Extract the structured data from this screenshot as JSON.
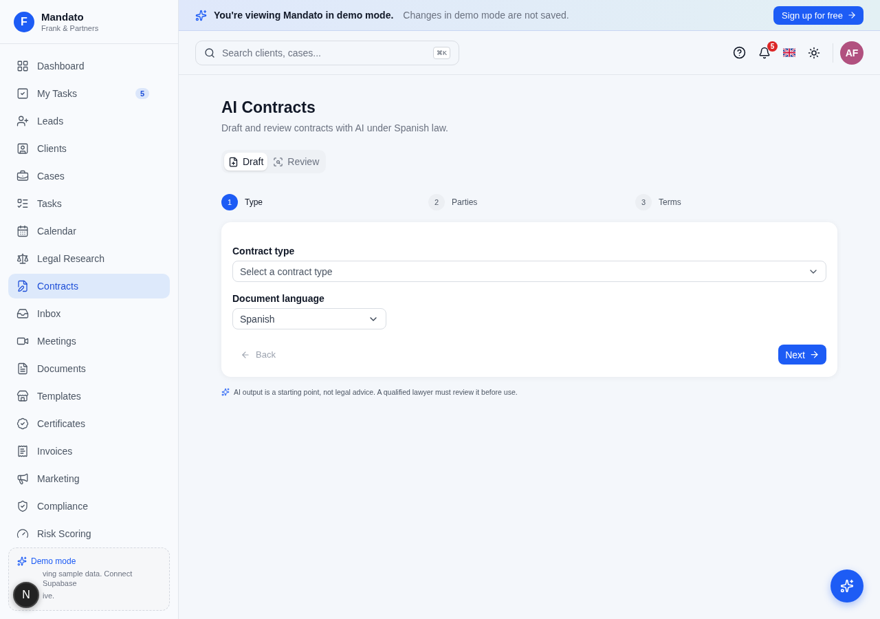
{
  "brand": {
    "initial": "F",
    "name": "Mandato",
    "org": "Frank & Partners"
  },
  "sidebar": {
    "items": [
      {
        "label": "Dashboard",
        "selected": false
      },
      {
        "label": "My Tasks",
        "selected": false,
        "badge": "5"
      },
      {
        "label": "Leads",
        "selected": false
      },
      {
        "label": "Clients",
        "selected": false
      },
      {
        "label": "Cases",
        "selected": false
      },
      {
        "label": "Tasks",
        "selected": false
      },
      {
        "label": "Calendar",
        "selected": false
      },
      {
        "label": "Legal Research",
        "selected": false
      },
      {
        "label": "Contracts",
        "selected": true
      },
      {
        "label": "Inbox",
        "selected": false
      },
      {
        "label": "Meetings",
        "selected": false
      },
      {
        "label": "Documents",
        "selected": false
      },
      {
        "label": "Templates",
        "selected": false
      },
      {
        "label": "Certificates",
        "selected": false
      },
      {
        "label": "Invoices",
        "selected": false
      },
      {
        "label": "Marketing",
        "selected": false
      },
      {
        "label": "Compliance",
        "selected": false
      },
      {
        "label": "Risk Scoring",
        "selected": false
      }
    ]
  },
  "demo_card": {
    "title": "Demo mode",
    "lines": [
      "ving sample data. Connect Supabase",
      "ive."
    ]
  },
  "dev_button": {
    "label": "N"
  },
  "banner": {
    "title": "You're viewing Mandato in demo mode.",
    "text": "Changes in demo mode are not saved.",
    "button": "Sign up for free"
  },
  "search": {
    "placeholder": "Search clients, cases...",
    "shortcut": "⌘K"
  },
  "notifications": {
    "count": "5"
  },
  "avatar": {
    "initials": "AF"
  },
  "page": {
    "title": "AI Contracts",
    "subtitle": "Draft and review contracts with AI under Spanish law."
  },
  "mode_tabs": [
    {
      "label": "Draft",
      "selected": true
    },
    {
      "label": "Review",
      "selected": false
    }
  ],
  "steps": [
    {
      "number": "1",
      "label": "Type",
      "selected": true
    },
    {
      "number": "2",
      "label": "Parties",
      "selected": false
    },
    {
      "number": "3",
      "label": "Terms",
      "selected": false
    }
  ],
  "form": {
    "contract_type": {
      "label": "Contract type",
      "placeholder": "Select a contract type"
    },
    "language": {
      "label": "Document language",
      "value": "Spanish"
    },
    "back": "Back",
    "next": "Next"
  },
  "disclaimer": "AI output is a starting point, not legal advice. A qualified lawyer must review it before use."
}
